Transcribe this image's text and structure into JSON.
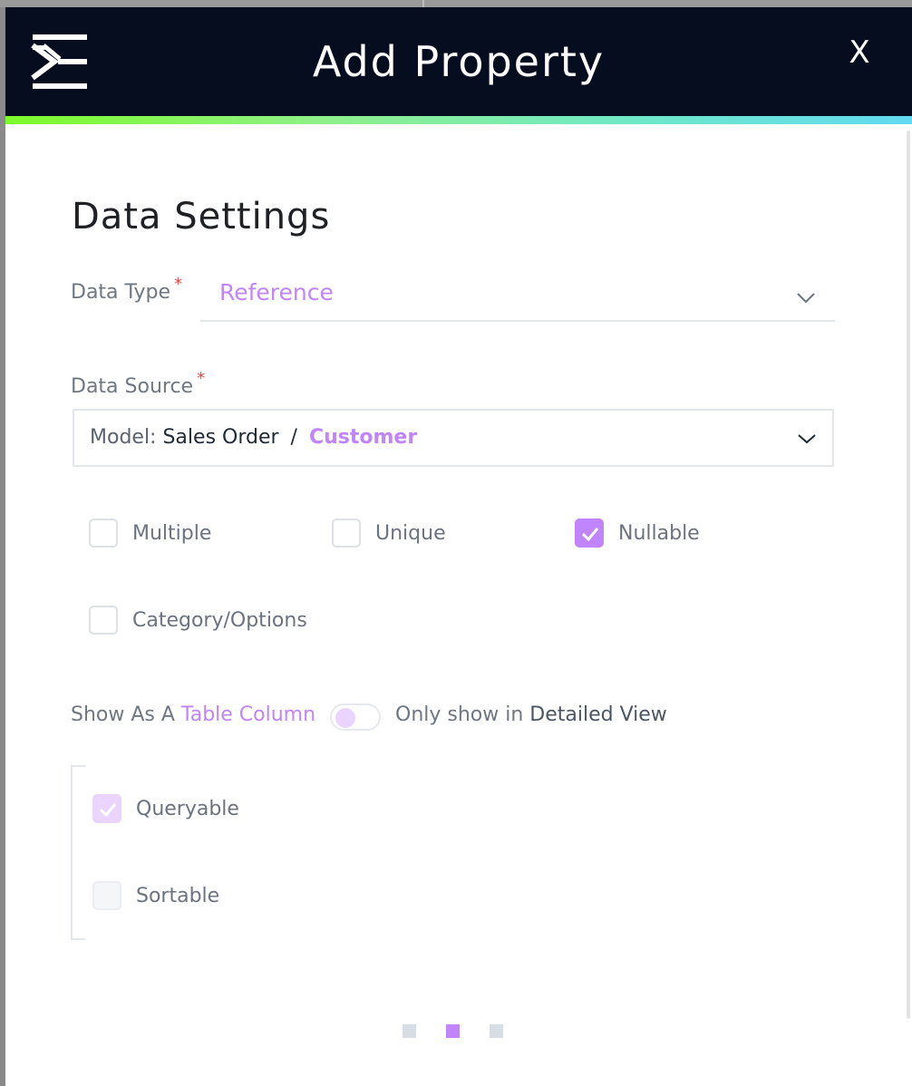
{
  "header": {
    "logo_icon": "brand-logo-icon",
    "title": "Add Property",
    "close_label": "X"
  },
  "section": {
    "title": "Data Settings"
  },
  "data_type": {
    "label": "Data Type",
    "required": "*",
    "value": "Reference",
    "chevron_icon": "chevron-down-icon"
  },
  "data_source": {
    "label": "Data Source",
    "required": "*",
    "model_prefix": "Model:",
    "model_value": "Sales Order",
    "separator": "/",
    "entity": "Customer",
    "chevron_icon": "chevron-down-icon"
  },
  "options": {
    "multiple": {
      "label": "Multiple",
      "checked": false
    },
    "unique": {
      "label": "Unique",
      "checked": false
    },
    "nullable": {
      "label": "Nullable",
      "checked": true
    },
    "category": {
      "label": "Category/Options",
      "checked": false
    }
  },
  "column_toggle": {
    "left_prefix": "Show As A",
    "left_accent": "Table Column",
    "right_prefix": "Only show in",
    "right_emphasis": "Detailed View",
    "state": "off"
  },
  "column_options": {
    "queryable": {
      "label": "Queryable",
      "checked": true
    },
    "sortable": {
      "label": "Sortable",
      "checked": false,
      "disabled": true
    }
  },
  "pager": {
    "total": 3,
    "active_index": 1
  },
  "colors": {
    "header_bg": "#050d1f",
    "accent": "#c084fc",
    "gradient_start": "#7dfa2a",
    "gradient_end": "#62d9f0",
    "required": "#ef4444"
  }
}
